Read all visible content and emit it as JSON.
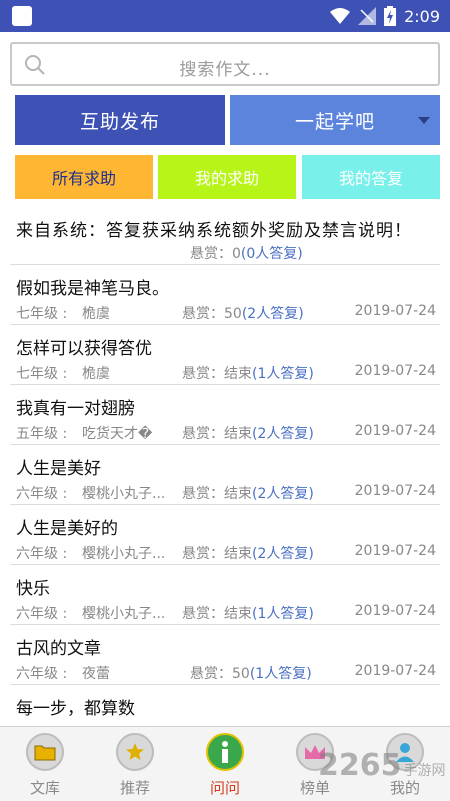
{
  "status": {
    "time": "2:09"
  },
  "search": {
    "placeholder": "搜索作文..."
  },
  "actions": {
    "publish": "互助发布",
    "study": "一起学吧"
  },
  "tabs": {
    "all": "所有求助",
    "mine": "我的求助",
    "answers": "我的答复"
  },
  "system_post": {
    "title": "来自系统：答复获采纳系统额外奖励及禁言说明！",
    "reward": "悬赏：0",
    "replies": "(0人答复)"
  },
  "posts": [
    {
      "title": "假如我是神笔马良。",
      "grade": "七年级 :",
      "author": "桅虞",
      "reward": "悬赏：50",
      "replies": "(2人答复)",
      "date": "2019-07-24"
    },
    {
      "title": "怎样可以获得答优",
      "grade": "七年级 :",
      "author": "桅虞",
      "reward": "悬赏：结束",
      "replies": "(1人答复)",
      "date": "2019-07-24"
    },
    {
      "title": "我真有一对翅膀",
      "grade": "五年级 :",
      "author": "吃货天才�",
      "reward": "悬赏：结束",
      "replies": "(2人答复)",
      "date": "2019-07-24"
    },
    {
      "title": "人生是美好",
      "grade": "六年级 :",
      "author": "樱桃小丸子...",
      "reward": "悬赏：结束",
      "replies": "(2人答复)",
      "date": "2019-07-24"
    },
    {
      "title": "人生是美好的",
      "grade": "六年级 :",
      "author": "樱桃小丸子...",
      "reward": "悬赏：结束",
      "replies": "(2人答复)",
      "date": "2019-07-24"
    },
    {
      "title": "快乐",
      "grade": "六年级 :",
      "author": "樱桃小丸子...",
      "reward": "悬赏：结束",
      "replies": "(1人答复)",
      "date": "2019-07-24"
    },
    {
      "title": "古风的文章",
      "grade": "六年级 :",
      "author": "夜蕾",
      "reward": "悬赏：50",
      "replies": "(1人答复)",
      "date": "2019-07-24"
    },
    {
      "title": "每一步，都算数",
      "grade": "",
      "author": "",
      "reward": "",
      "replies": "",
      "date": ""
    }
  ],
  "tabbar": {
    "library": "文库",
    "recommend": "推荐",
    "ask": "问问",
    "rank": "榜单",
    "mine": "我的"
  },
  "watermark": {
    "text": "2265",
    "sub": "手游网"
  }
}
